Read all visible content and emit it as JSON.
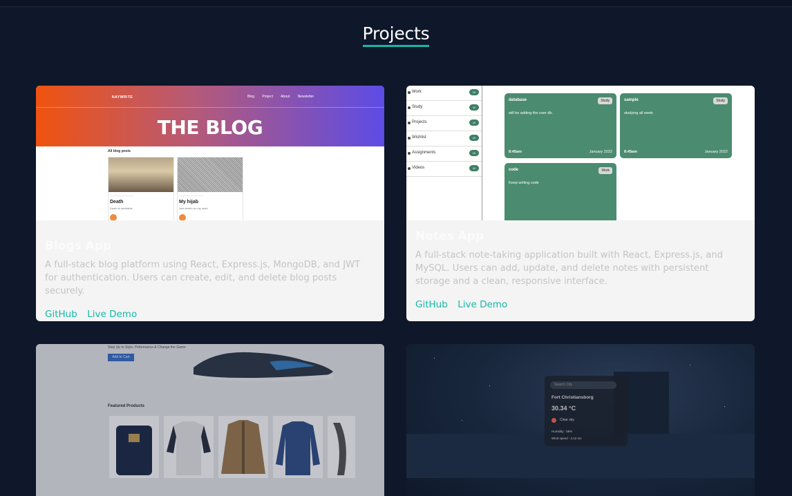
{
  "section": {
    "title": "Projects"
  },
  "projects": [
    {
      "title": "Blogs App",
      "description": "A full-stack blog platform using React, Express.js, MongoDB, and JWT for authentication. Users can create, edit, and delete blog posts securely.",
      "github_label": "GitHub",
      "demo_label": "Live Demo",
      "preview": {
        "logo": "NAYWRITE",
        "nav": [
          "Blog",
          "Project",
          "About",
          "Newsletter"
        ],
        "headline": "THE BLOG",
        "section_label": "All blog posts",
        "posts": [
          {
            "title": "Death",
            "snippet": "Death is inevitable"
          },
          {
            "title": "My hijab",
            "snippet": "Just what's on my mind"
          }
        ]
      }
    },
    {
      "title": "Notes App",
      "description": "A full-stack note-taking application built with React, Express.js, and MySQL. Users can add, update, and delete notes with persistent storage and a clean, responsive interface.",
      "github_label": "GitHub",
      "demo_label": "Live Demo",
      "preview": {
        "categories": [
          "Work",
          "Study",
          "Projects",
          "Wishlist",
          "Assignments",
          "Videos"
        ],
        "notes": [
          {
            "title": "database",
            "tag": "Study",
            "body": "will be adding the user db.",
            "time": "8:45am",
            "date": "January 2022"
          },
          {
            "title": "sample",
            "tag": "Study",
            "body": "studying all week",
            "time": "8:45am",
            "date": "January 2022"
          },
          {
            "title": "code",
            "tag": "Work",
            "body": "Keep writing code",
            "time": "",
            "date": ""
          }
        ]
      }
    },
    {
      "preview": {
        "tagline": "Step Up to Style, Peformance & Change the Game",
        "cart_label": "Add to Cart",
        "featured_label": "Featured Products"
      }
    },
    {
      "preview": {
        "search_placeholder": "Search City",
        "city": "Fort Christiansborg",
        "temperature": "30.34 °C",
        "condition": "Clear sky",
        "humidity": "Humidity : 59%",
        "wind": "Wind speed : 4.12 ms"
      }
    }
  ]
}
